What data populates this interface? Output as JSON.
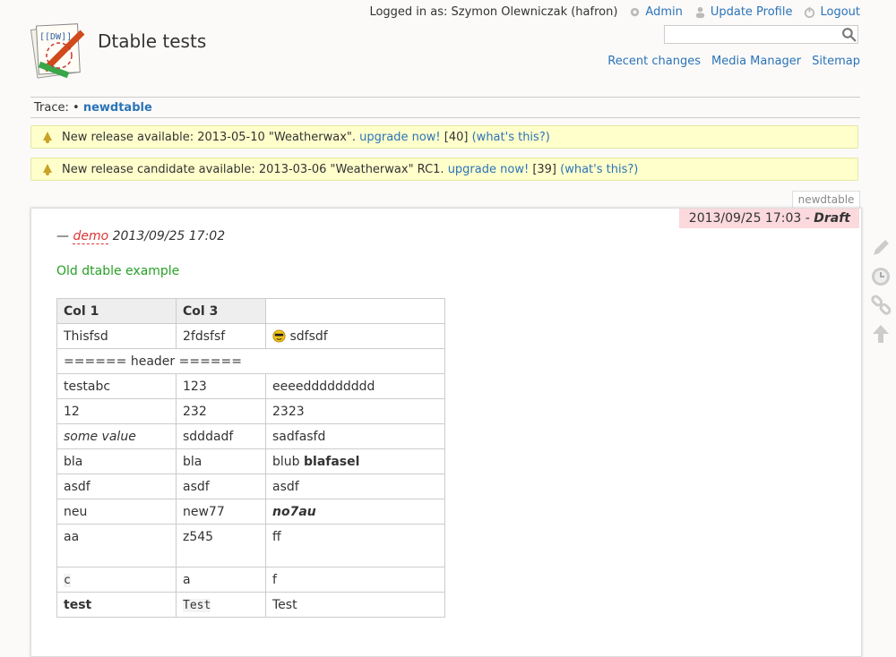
{
  "site": {
    "title": "Dtable tests",
    "logo_label": "[[DW]]"
  },
  "userbar": {
    "logged_in_as": "Logged in as: Szymon Olewniczak (hafron)",
    "admin": "Admin",
    "update_profile": "Update Profile",
    "logout": "Logout"
  },
  "search": {
    "value": ""
  },
  "topnav": {
    "recent": "Recent changes",
    "media": "Media Manager",
    "sitemap": "Sitemap"
  },
  "trace": {
    "label": "Trace:",
    "bullet": "•",
    "page": "newdtable"
  },
  "notices": [
    {
      "text": "New release available: 2013-05-10 \"Weatherwax\".",
      "upgrade": "upgrade now!",
      "num": "[40]",
      "what": "(what's this?)"
    },
    {
      "text": "New release candidate available: 2013-03-06 \"Weatherwax\" RC1.",
      "upgrade": "upgrade now!",
      "num": "[39]",
      "what": "(what's this?)"
    }
  ],
  "page": {
    "tab": "newdtable",
    "draft_date": "2013/09/25 17:03 -",
    "draft_label": "Draft",
    "sig_dash": "—",
    "sig_user": "demo",
    "sig_date": "2013/09/25 17:02",
    "old_title": "Old dtable example"
  },
  "table": {
    "headers": [
      "Col 1",
      "Col 3",
      ""
    ],
    "r1": [
      "Thisfsd",
      "2fdsfsf",
      "sdfsdf"
    ],
    "header_row": "====== header ======",
    "r3": [
      "testabc",
      "123",
      "eeeeddddddddd"
    ],
    "r4": [
      "12",
      "232",
      "2323"
    ],
    "r5": [
      "some value",
      "sdddadf",
      "sadfasfd"
    ],
    "r6": [
      "bla",
      "bla",
      "blub",
      "blafasel"
    ],
    "r7": [
      "asdf",
      "asdf",
      "asdf"
    ],
    "r8": [
      "neu",
      "new77",
      "no7au"
    ],
    "r9": [
      "aa",
      "z545",
      "ff"
    ],
    "r10": [
      "c",
      "a",
      "f"
    ],
    "r11": [
      "test",
      "Test",
      "Test"
    ]
  },
  "colors": {
    "link": "#2b73b7",
    "notice_bg": "#ffffcc",
    "draft_bg": "#fbd9dc",
    "green": "#28a026"
  }
}
